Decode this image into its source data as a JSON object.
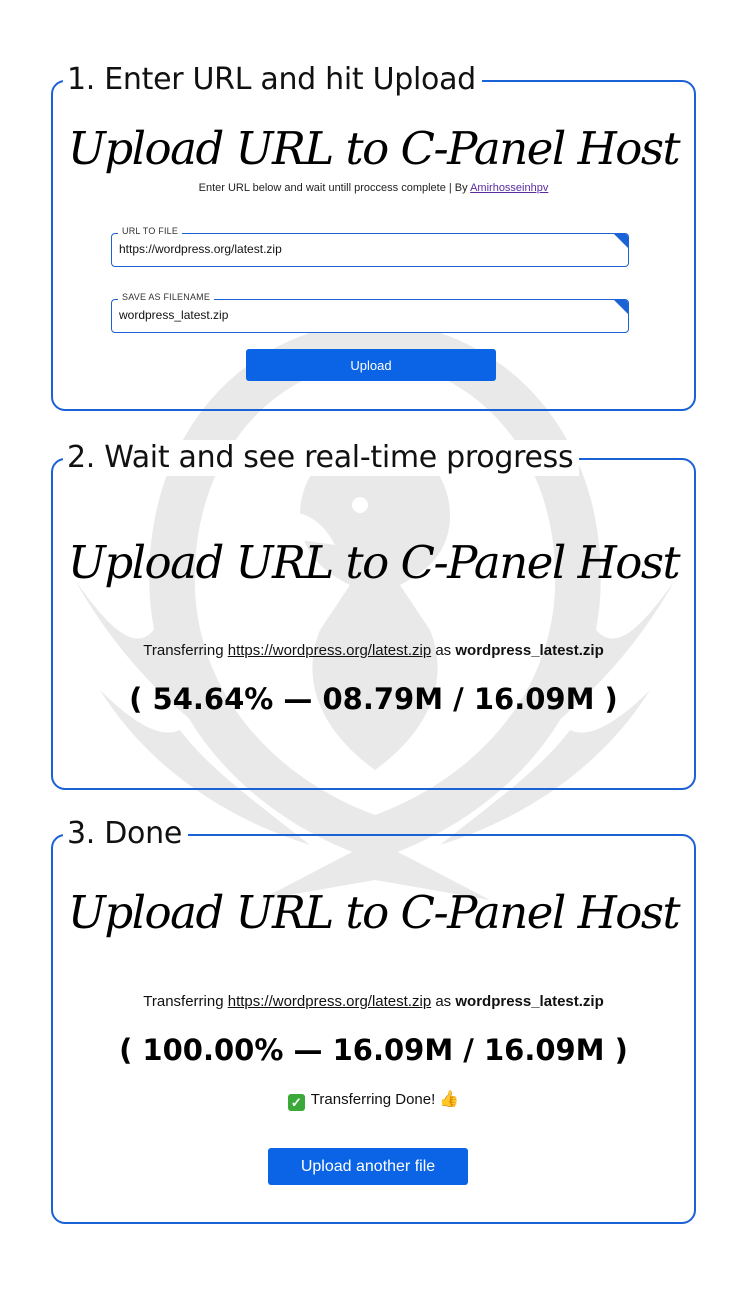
{
  "panels": [
    {
      "legend": "1. Enter URL and hit Upload",
      "title": "Upload URL to C-Panel Host",
      "subtitle_text": "Enter URL below and wait untill proccess complete | By ",
      "subtitle_link": "Amirhosseinhpv",
      "url_field": {
        "label": "URL TO FILE",
        "value": "https://wordpress.org/latest.zip"
      },
      "filename_field": {
        "label": "SAVE AS FILENAME",
        "value": "wordpress_latest.zip"
      },
      "upload_button": "Upload"
    },
    {
      "legend": "2. Wait and see real-time progress",
      "title": "Upload URL to C-Panel Host",
      "transfer_prefix": "Transferring",
      "transfer_url": "https://wordpress.org/latest.zip",
      "transfer_as": "as",
      "transfer_filename": "wordpress_latest.zip",
      "progress_text": "( 54.64% — 08.79M / 16.09M )",
      "progress_percent": 54.64
    },
    {
      "legend": "3. Done",
      "title": "Upload URL to C-Panel Host",
      "transfer_prefix": "Transferring",
      "transfer_url": "https://wordpress.org/latest.zip",
      "transfer_as": "as",
      "transfer_filename": "wordpress_latest.zip",
      "progress_text": "( 100.00% — 16.09M / 16.09M )",
      "progress_percent": 100,
      "done_text": "Transferring Done!",
      "upload_another_button": "Upload another file"
    }
  ],
  "icons": {
    "check": "check-mark-icon",
    "thumb": "thumbs-up-icon",
    "watermark": "phoenix-logo"
  },
  "colors": {
    "accent": "#1a62d6",
    "button": "#0b63e5",
    "link": "#5a2ca0"
  }
}
